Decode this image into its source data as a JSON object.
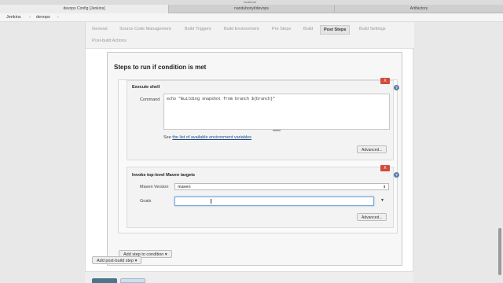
{
  "browser": {
    "window_title": "localhost",
    "tabs": [
      {
        "label": "devops Config [Jenkins]",
        "active": true
      },
      {
        "label": "nanduboriyt/devops",
        "active": false
      },
      {
        "label": "Artifactory",
        "active": false
      }
    ]
  },
  "breadcrumb": {
    "root": "Jenkins",
    "sep1": "›",
    "project": "devops",
    "sep2": "›"
  },
  "config_tabs": [
    {
      "label": "General"
    },
    {
      "label": "Source Code Management"
    },
    {
      "label": "Build Triggers"
    },
    {
      "label": "Build Environment"
    },
    {
      "label": "Pre Steps"
    },
    {
      "label": "Build"
    },
    {
      "label": "Post Steps",
      "active": true
    },
    {
      "label": "Build Settings"
    },
    {
      "label": "Post-build Actions"
    }
  ],
  "section": {
    "title": "Steps to run if condition is met"
  },
  "execute_shell": {
    "heading": "Execute shell",
    "delete_label": "X",
    "help_label": "?",
    "command_label": "Command",
    "command_value": "echo \"Building snapshot from branch ${branch}\"",
    "see_prefix": "See ",
    "env_link": "the list of available environment variables",
    "advanced_label": "Advanced..."
  },
  "maven_step": {
    "heading": "Invoke top-level Maven targets",
    "delete_label": "X",
    "help_label": "?",
    "maven_version_label": "Maven Version",
    "maven_version_value": "maven",
    "select_arrow": "⬍",
    "goals_label": "Goals",
    "goals_value": "",
    "goals_expand": "▼",
    "advanced_label": "Advanced..."
  },
  "add_step": {
    "label": "Add step to condition",
    "caret": "▾"
  },
  "add_post_build": {
    "label": "Add post-build step",
    "caret": "▾"
  },
  "colors": {
    "delete_red": "#d24b3a",
    "help_blue": "#5d7fa8",
    "link_blue": "#204a87",
    "save_blue": "#4b758b"
  }
}
